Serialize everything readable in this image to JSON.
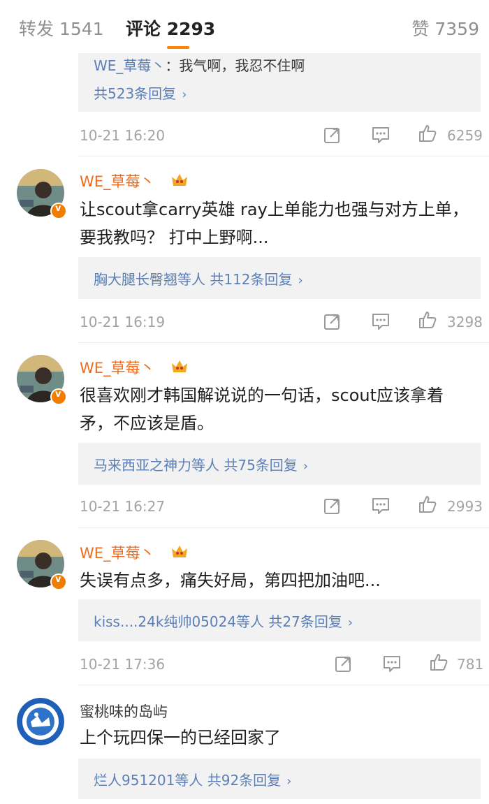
{
  "tabs": {
    "repost": "转发 1541",
    "comments": "评论 2293",
    "likes": "赞 7359"
  },
  "top_comment": {
    "reply_user": "WE_草莓丶",
    "reply_text": "：我气啊，我忍不住啊",
    "reply_count": "共523条回复",
    "time": "10-21 16:20",
    "likes": "6259"
  },
  "comments": [
    {
      "username": "WE_草莓丶",
      "text": "让scout拿carry英雄 ray上单能力也强与对方上单，要我教吗？ 打中上野啊...",
      "reply_users": "胸大腿长臀翘等人",
      "reply_count": "共112条回复",
      "time": "10-21 16:19",
      "likes": "3298"
    },
    {
      "username": "WE_草莓丶",
      "text": "很喜欢刚才韩国解说说的一句话，scout应该拿着矛，不应该是盾。",
      "reply_users": "马来西亚之神力等人",
      "reply_count": "共75条回复",
      "time": "10-21 16:27",
      "likes": "2993"
    },
    {
      "username": "WE_草莓丶",
      "text": "失误有点多，痛失好局，第四把加油吧...",
      "reply_users": "kiss....24k纯帅05024等人",
      "reply_count": "共27条回复",
      "time": "10-21 17:36",
      "likes": "781"
    },
    {
      "username": "蜜桃味的岛屿",
      "text": "上个玩四保一的已经回家了",
      "reply_users": "烂人951201等人",
      "reply_count": "共92条回复"
    }
  ],
  "icons": {
    "repost": "repost-icon",
    "comment": "comment-icon",
    "like": "thumbs-up-icon",
    "chevron": "chevron-right-icon"
  },
  "colors": {
    "accent": "#ff8200",
    "username_vip": "#f26b1b",
    "link": "#5b7fb6",
    "meta": "#a3a3a3"
  }
}
